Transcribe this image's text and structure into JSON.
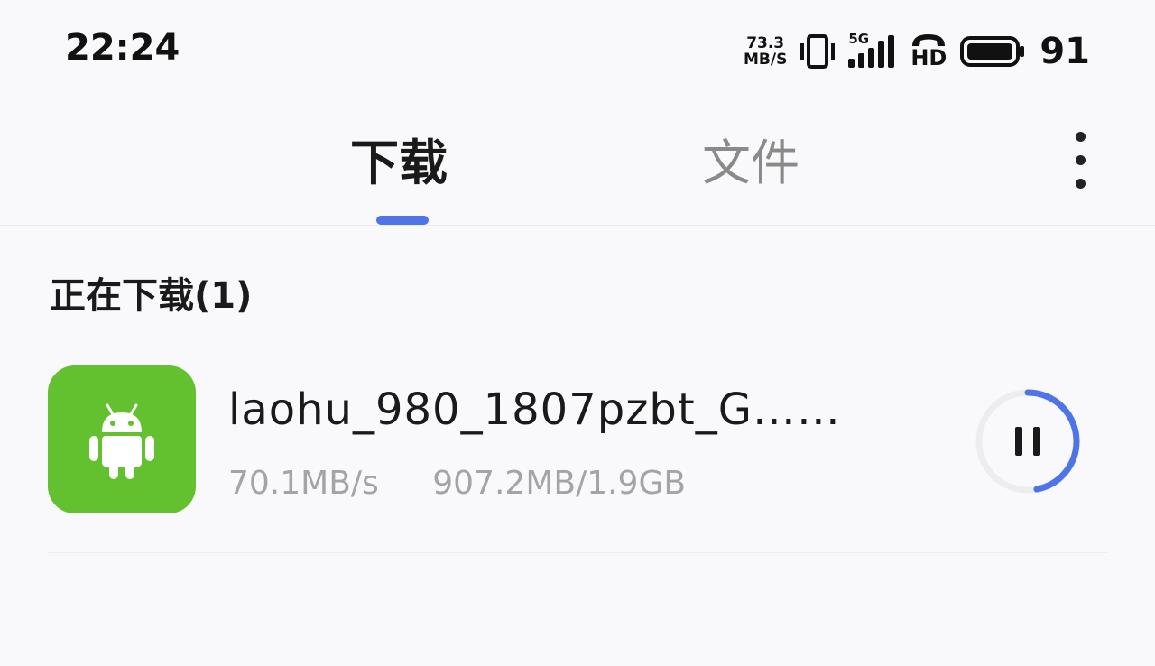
{
  "status_bar": {
    "time": "22:24",
    "net_speed_value": "73.3",
    "net_speed_unit": "MB/S",
    "network_label": "5G",
    "hd_label": "HD",
    "battery_level": "91"
  },
  "tabs": [
    {
      "label": "下载",
      "active": true
    },
    {
      "label": "文件",
      "active": false
    }
  ],
  "section": {
    "title": "正在下载(1)"
  },
  "downloads": [
    {
      "file_name": "laohu_980_1807pzbt_G……",
      "speed": "70.1MB/s",
      "progress_text": "907.2MB/1.9GB",
      "progress_fraction": 0.47,
      "icon": "android-icon"
    }
  ],
  "colors": {
    "accent": "#4e74e8",
    "app_icon_bg": "#63c02e",
    "secondary_text": "#a4a4a8"
  }
}
